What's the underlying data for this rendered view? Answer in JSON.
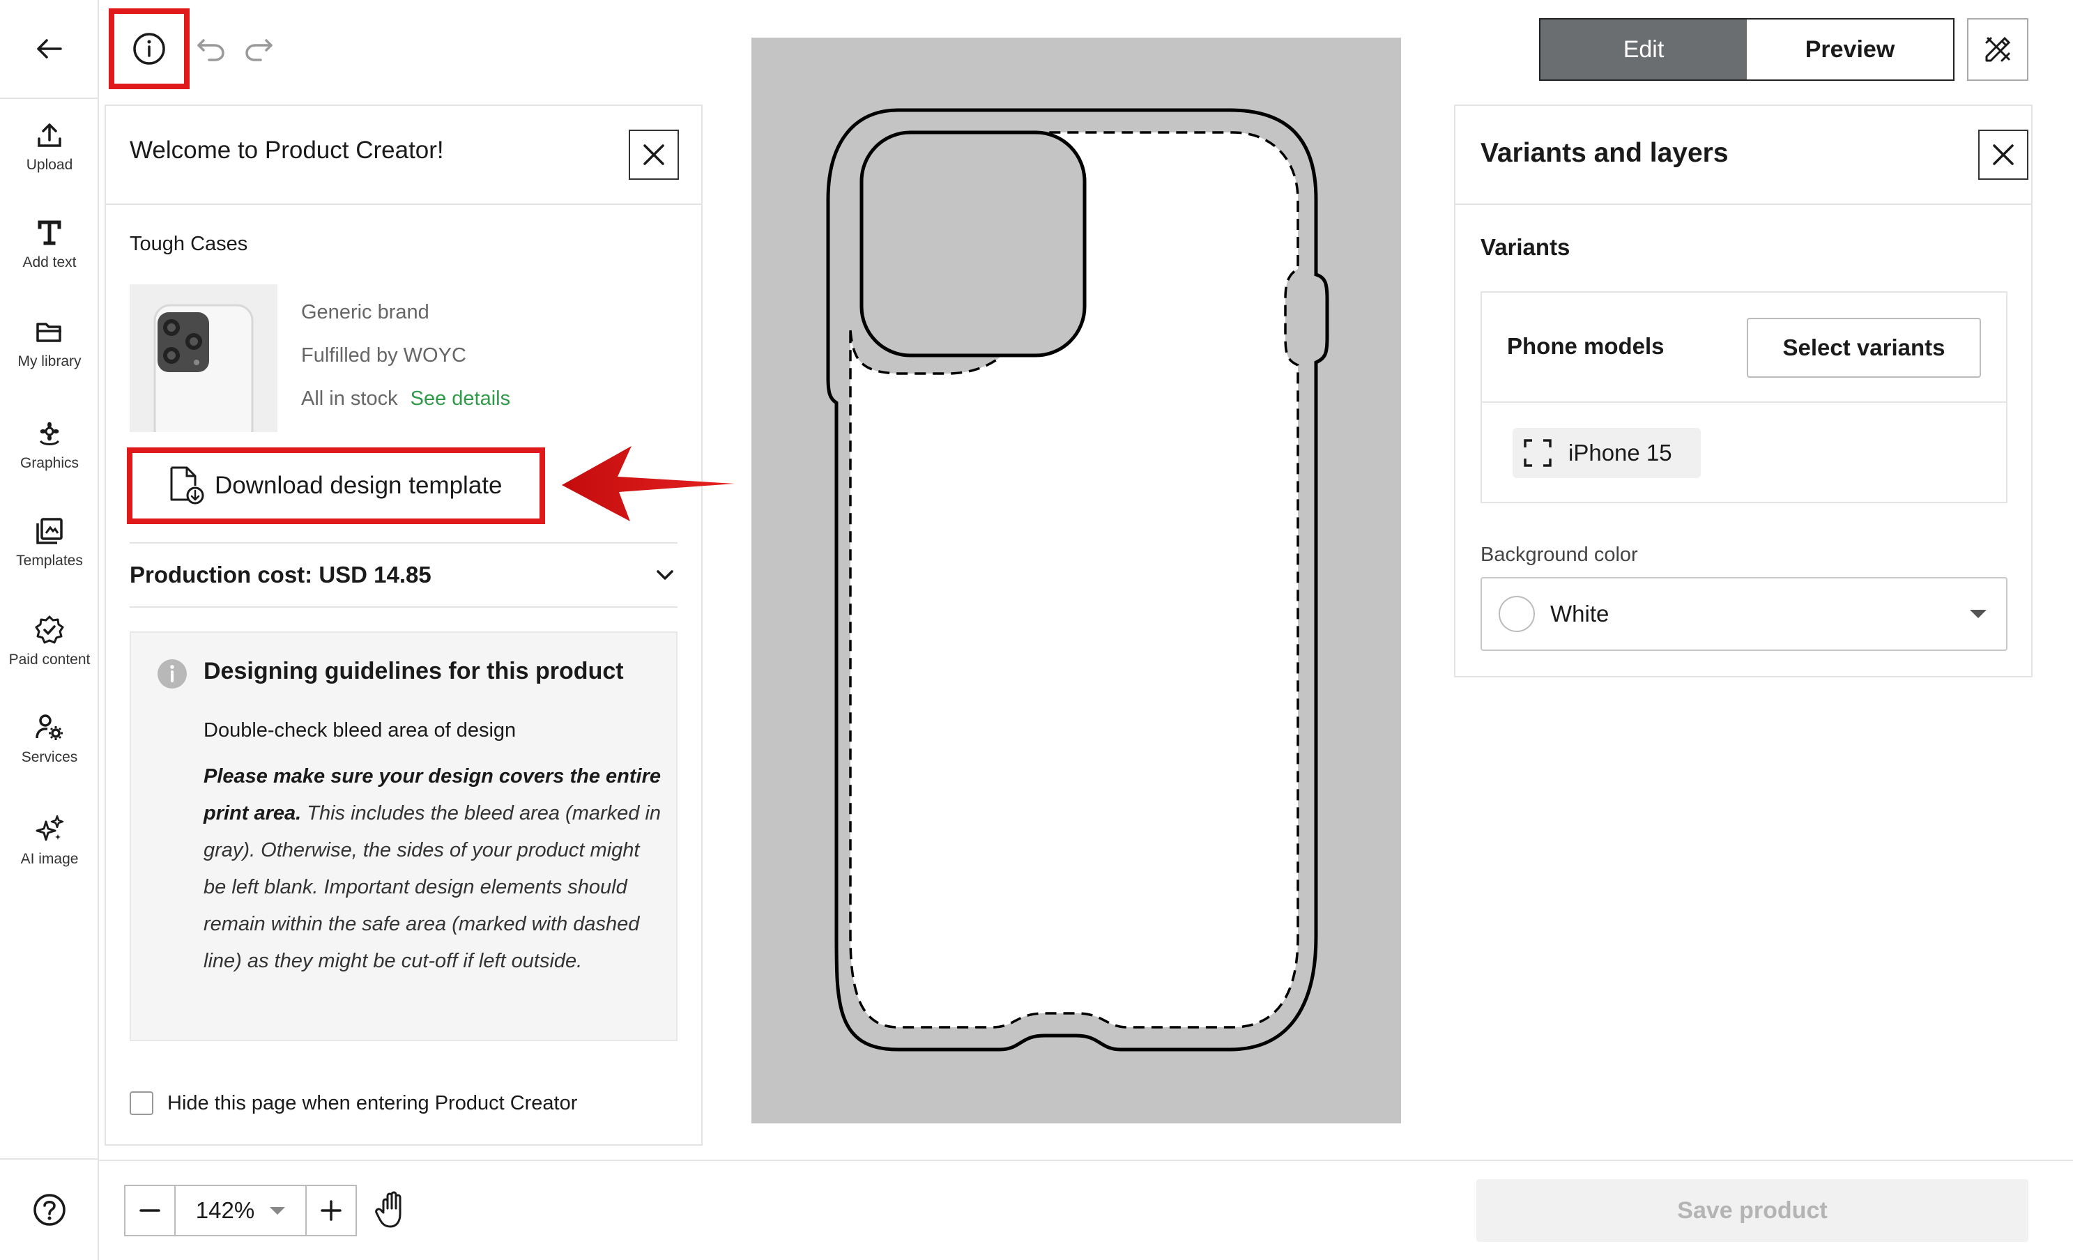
{
  "rail": {
    "items": [
      {
        "label": "Upload",
        "icon": "upload-icon"
      },
      {
        "label": "Add text",
        "icon": "text-icon"
      },
      {
        "label": "My library",
        "icon": "folder-icon"
      },
      {
        "label": "Graphics",
        "icon": "flower-icon"
      },
      {
        "label": "Templates",
        "icon": "templates-icon"
      },
      {
        "label": "Paid content",
        "icon": "badge-check-icon"
      },
      {
        "label": "Services",
        "icon": "services-icon"
      },
      {
        "label": "AI image",
        "icon": "sparkle-icon"
      }
    ]
  },
  "toolbar": {
    "edit_label": "Edit",
    "preview_label": "Preview"
  },
  "welcome": {
    "title": "Welcome to Product Creator!",
    "product_name": "Tough Cases",
    "brand": "Generic brand",
    "fulfilled": "Fulfilled by WOYC",
    "stock": "All in stock",
    "see_details": "See details",
    "download_label": "Download design template",
    "production_cost": "Production cost: USD 14.85",
    "guide_title": "Designing guidelines for this product",
    "guide_sub": "Double-check bleed area of design",
    "guide_bold": "Please make sure your design covers the entire print area.",
    "guide_text": " This includes the bleed area (marked in gray). Otherwise, the sides of your product might be left blank. Important design elements should remain within the safe area (marked with dashed line) as they might be cut-off if left outside.",
    "hide_label": "Hide this page when entering Product Creator"
  },
  "variants_panel": {
    "title": "Variants and layers",
    "section": "Variants",
    "phone_models": "Phone models",
    "select_variants": "Select variants",
    "chip": "iPhone 15",
    "bg_label": "Background color",
    "bg_value": "White"
  },
  "zoom": {
    "value": "142%"
  },
  "save_label": "Save product",
  "colors": {
    "highlight": "#e01a1a",
    "edit_active": "#6b6e70",
    "link_green": "#2e9a48",
    "canvas_gray": "#c4c4c4"
  }
}
